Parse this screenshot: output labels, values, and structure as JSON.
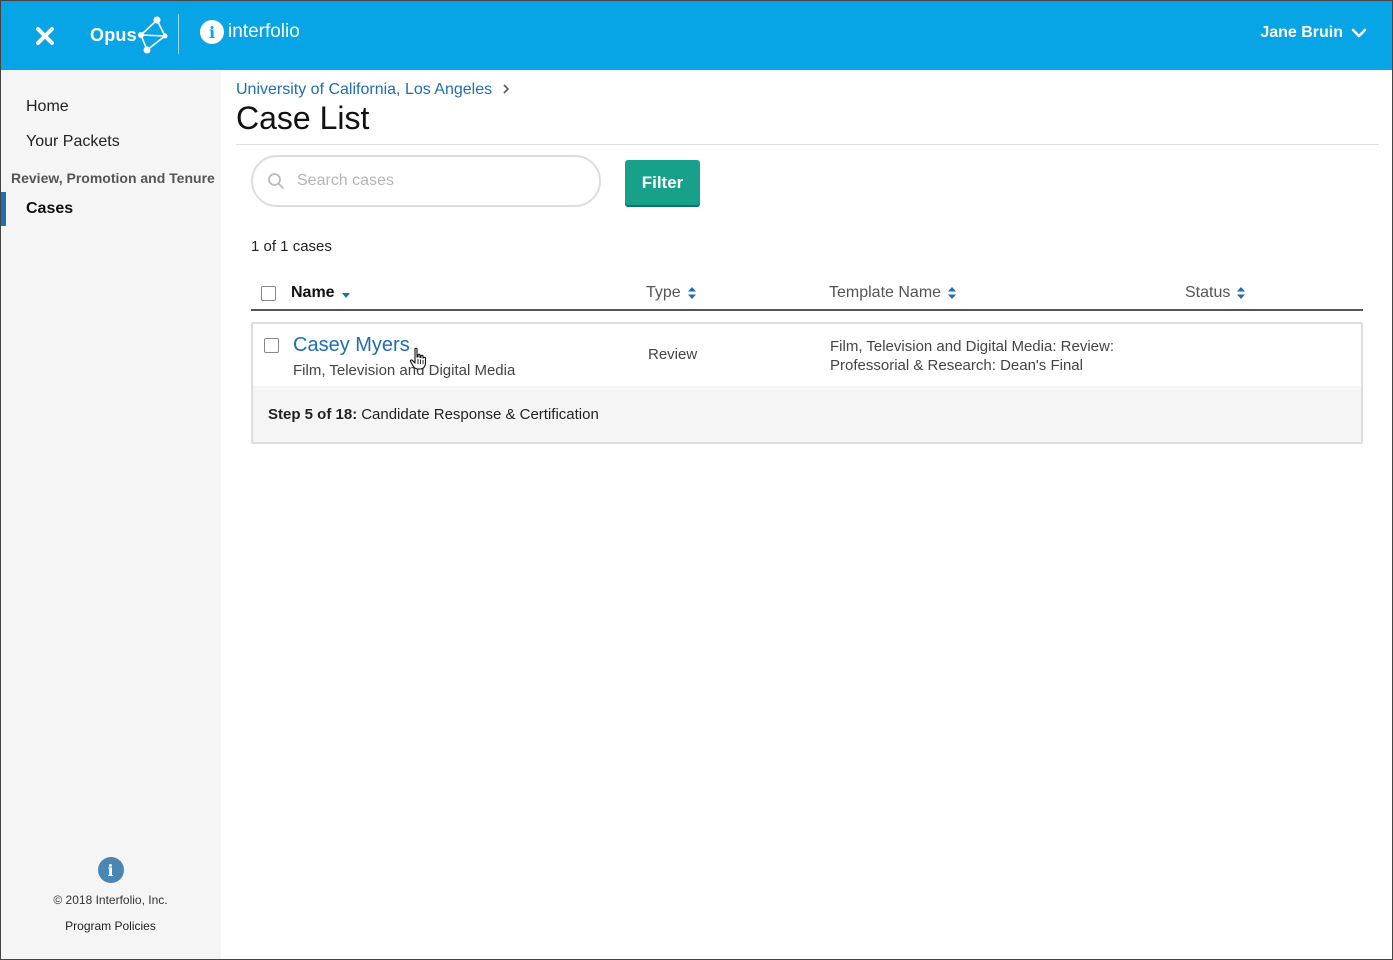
{
  "topbar": {
    "product_name": "Opus",
    "brand_name": "interfolio",
    "brand_initial": "i",
    "user_name": "Jane Bruin",
    "accent_color": "#08a5e6"
  },
  "sidebar": {
    "items": [
      {
        "label": "Home"
      },
      {
        "label": "Your Packets"
      }
    ],
    "section_label": "Review, Promotion and Tenure",
    "active_item": {
      "label": "Cases"
    },
    "footer": {
      "info_initial": "i",
      "copyright": "© 2018 Interfolio, Inc.",
      "policies_label": "Program Policies"
    }
  },
  "main": {
    "breadcrumb": {
      "institution": "University of California, Los Angeles",
      "separator": ">"
    },
    "title": "Case List",
    "search": {
      "placeholder": "Search cases",
      "value": ""
    },
    "filter_label": "Filter",
    "count_text": "1 of 1 cases",
    "columns": {
      "name": "Name",
      "type": "Type",
      "template": "Template Name",
      "status": "Status"
    },
    "cases": [
      {
        "name": "Casey Myers",
        "department": "Film, Television and Digital Media",
        "type": "Review",
        "template_line1": "Film, Television and Digital Media: Review:",
        "template_line2": "Professorial & Research: Dean's Final",
        "status": "",
        "step_label": "Step 5 of 18:",
        "step_name": "Candidate Response & Certification"
      }
    ],
    "link_color": "#1f6db3",
    "button_color": "#17a08a"
  }
}
